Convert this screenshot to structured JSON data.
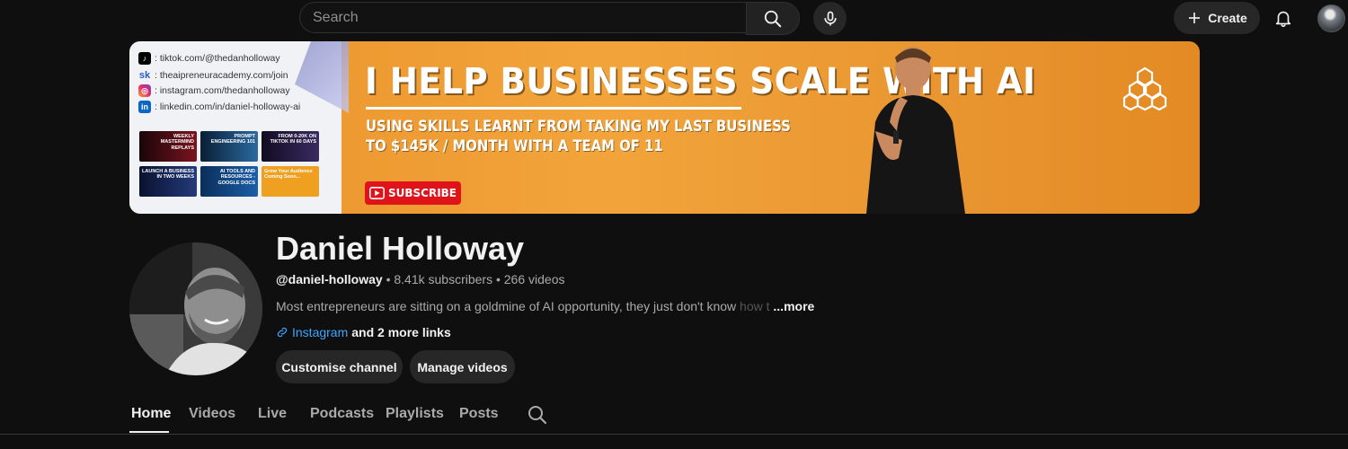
{
  "header": {
    "search_placeholder": "Search",
    "create_label": "Create"
  },
  "banner": {
    "links": [
      {
        "icon": "tiktok-icon",
        "text": ": tiktok.com/@thedanholloway"
      },
      {
        "icon": "skool-icon",
        "text": ": theaipreneuracademy.com/join"
      },
      {
        "icon": "instagram-icon",
        "text": ": instagram.com/thedanholloway"
      },
      {
        "icon": "linkedin-icon",
        "text": ": linkedin.com/in/daniel-holloway-ai"
      }
    ],
    "thumbnails": [
      {
        "text": "WEEKLY MASTERMIND REPLAYS",
        "color": "#3a0d12"
      },
      {
        "text": "PROMPT ENGINEERING 101",
        "color": "#0e2a44"
      },
      {
        "text": "FROM 0-20K ON TIKTOK IN 60 DAYS",
        "color": "#1b1230"
      },
      {
        "text": "LAUNCH A BUSINESS IN TWO WEEKS",
        "color": "#0f1b3a"
      },
      {
        "text": "AI TOOLS AND RESOURCES - GOOGLE DOCS",
        "color": "#0d3a6a"
      },
      {
        "text": "Grow Your Audience Coming Soon...",
        "color": "#f0a020"
      }
    ],
    "title": "I HELP BUSINESSES SCALE WITH AI",
    "subtitle_line1": "USING SKILLS LEARNT FROM TAKING MY LAST BUSINESS",
    "subtitle_line2": "TO $145K / MONTH WITH A TEAM OF 11",
    "subscribe_label": "SUBSCRIBE"
  },
  "channel": {
    "name": "Daniel Holloway",
    "handle": "@daniel-holloway",
    "subscribers": "8.41k subscribers",
    "videos": "266 videos",
    "separator": "•",
    "description": "Most entrepreneurs are sitting on a goldmine of AI opportunity, they just don't know",
    "description_fade": "how t",
    "more_label": "...more",
    "link_label": "Instagram",
    "more_links_label": "and 2 more links",
    "customise_label": "Customise channel",
    "manage_label": "Manage videos"
  },
  "tabs": [
    {
      "label": "Home",
      "active": true
    },
    {
      "label": "Videos",
      "active": false
    },
    {
      "label": "Live",
      "active": false
    },
    {
      "label": "Podcasts",
      "active": false
    },
    {
      "label": "Playlists",
      "active": false
    },
    {
      "label": "Posts",
      "active": false
    }
  ],
  "colors": {
    "background": "#0f0f0f",
    "banner_orange": "#f2a43a",
    "link_blue": "#3ea6ff",
    "subscribe_red": "#e0131b"
  }
}
